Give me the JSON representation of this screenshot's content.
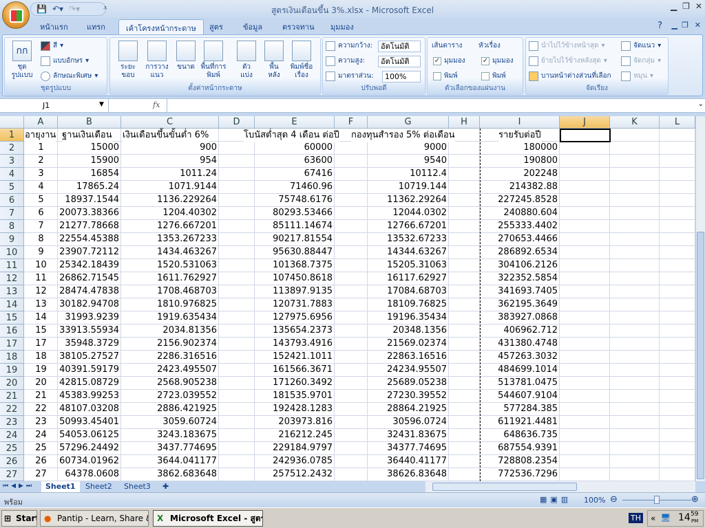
{
  "window": {
    "title": "สูตรเงินเดือนขึ้น 3%.xlsx - Microsoft Excel"
  },
  "ribbon_tabs": [
    "หน้าแรก",
    "แทรก",
    "เค้าโครงหน้ากระดาษ",
    "สูตร",
    "ข้อมูล",
    "ตรวจทาน",
    "มุมมอง"
  ],
  "active_tab": "เค้าโครงหน้ากระดาษ",
  "groups": {
    "themes": {
      "label": "ชุดรูปแบบ",
      "themes_btn": "ชุด\nรูปแบบ",
      "colors": "สี",
      "fonts": "แบบอักษร",
      "effects": "ลักษณะพิเศษ"
    },
    "page_setup": {
      "label": "ตั้งค่าหน้ากระดาษ",
      "items": [
        "ระยะ\nขอบ",
        "การวาง\nแนว",
        "ขนาด",
        "พื้นที่การ\nพิมพ์",
        "ตัว\nแบ่ง",
        "พื้น\nหลัง",
        "พิมพ์ชื่อ\nเรื่อง"
      ]
    },
    "scale": {
      "label": "ปรับพอดี",
      "width_label": "ความกว้าง:",
      "width_value": "อัตโนมัติ",
      "height_label": "ความสูง:",
      "height_value": "อัตโนมัติ",
      "scale_label": "มาตราส่วน:",
      "scale_value": "100%"
    },
    "sheet_options": {
      "label": "ตัวเลือกของแผ่นงาน",
      "gridlines": "เส้นตาราง",
      "headings": "หัวเรื่อง",
      "view": "มุมมอง",
      "print": "พิมพ์",
      "gridlines_view": true,
      "gridlines_print": false,
      "headings_view": true,
      "headings_print": false
    },
    "arrange": {
      "label": "จัดเรียง",
      "bring_front": "นำไปไว้ข้างหน้าสุด",
      "send_back": "ย้ายไปไว้ข้างหลังสุด",
      "selection_pane": "บานหน้าต่างส่วนที่เลือก",
      "align": "จัดแนว",
      "group": "จัดกลุ่ม",
      "rotate": "หมุน"
    }
  },
  "formula_bar": {
    "name_box": "J1",
    "fx": "fx",
    "formula": ""
  },
  "columns": [
    "A",
    "B",
    "C",
    "D",
    "E",
    "F",
    "G",
    "H",
    "I",
    "J",
    "K",
    "L"
  ],
  "active_cell": "J1",
  "headers": {
    "A": "อายุงาน",
    "B": "ฐานเงินเดือน",
    "C": "เงินเดือนขึ้นขั้นต่ำ 6%",
    "E": "โบนัสต่ำสุด 4 เดือน ต่อปี",
    "G": "กองทุนสำรอง 5% ต่อเดือน",
    "I": "รายรับต่อปี"
  },
  "rows": [
    [
      "1",
      "15000",
      "900",
      "60000",
      "9000",
      "180000"
    ],
    [
      "2",
      "15900",
      "954",
      "63600",
      "9540",
      "190800"
    ],
    [
      "3",
      "16854",
      "1011.24",
      "67416",
      "10112.4",
      "202248"
    ],
    [
      "4",
      "17865.24",
      "1071.9144",
      "71460.96",
      "10719.144",
      "214382.88"
    ],
    [
      "5",
      "18937.1544",
      "1136.229264",
      "75748.6176",
      "11362.29264",
      "227245.8528"
    ],
    [
      "6",
      "20073.38366",
      "1204.40302",
      "80293.53466",
      "12044.0302",
      "240880.604"
    ],
    [
      "7",
      "21277.78668",
      "1276.667201",
      "85111.14674",
      "12766.67201",
      "255333.4402"
    ],
    [
      "8",
      "22554.45388",
      "1353.267233",
      "90217.81554",
      "13532.67233",
      "270653.4466"
    ],
    [
      "9",
      "23907.72112",
      "1434.463267",
      "95630.88447",
      "14344.63267",
      "286892.6534"
    ],
    [
      "10",
      "25342.18439",
      "1520.531063",
      "101368.7375",
      "15205.31063",
      "304106.2126"
    ],
    [
      "11",
      "26862.71545",
      "1611.762927",
      "107450.8618",
      "16117.62927",
      "322352.5854"
    ],
    [
      "12",
      "28474.47838",
      "1708.468703",
      "113897.9135",
      "17084.68703",
      "341693.7405"
    ],
    [
      "13",
      "30182.94708",
      "1810.976825",
      "120731.7883",
      "18109.76825",
      "362195.3649"
    ],
    [
      "14",
      "31993.9239",
      "1919.635434",
      "127975.6956",
      "19196.35434",
      "383927.0868"
    ],
    [
      "15",
      "33913.55934",
      "2034.81356",
      "135654.2373",
      "20348.1356",
      "406962.712"
    ],
    [
      "17",
      "35948.3729",
      "2156.902374",
      "143793.4916",
      "21569.02374",
      "431380.4748"
    ],
    [
      "18",
      "38105.27527",
      "2286.316516",
      "152421.1011",
      "22863.16516",
      "457263.3032"
    ],
    [
      "19",
      "40391.59179",
      "2423.495507",
      "161566.3671",
      "24234.95507",
      "484699.1014"
    ],
    [
      "20",
      "42815.08729",
      "2568.905238",
      "171260.3492",
      "25689.05238",
      "513781.0475"
    ],
    [
      "21",
      "45383.99253",
      "2723.039552",
      "181535.9701",
      "27230.39552",
      "544607.9104"
    ],
    [
      "22",
      "48107.03208",
      "2886.421925",
      "192428.1283",
      "28864.21925",
      "577284.385"
    ],
    [
      "23",
      "50993.45401",
      "3059.60724",
      "203973.816",
      "30596.0724",
      "611921.4481"
    ],
    [
      "24",
      "54053.06125",
      "3243.183675",
      "216212.245",
      "32431.83675",
      "648636.735"
    ],
    [
      "25",
      "57296.24492",
      "3437.774695",
      "229184.9797",
      "34377.74695",
      "687554.9391"
    ],
    [
      "26",
      "60734.01962",
      "3644.041177",
      "242936.0785",
      "36440.41177",
      "728808.2354"
    ],
    [
      "27",
      "64378.0608",
      "3862.683648",
      "257512.2432",
      "38626.83648",
      "772536.7296"
    ]
  ],
  "sheets": [
    "Sheet1",
    "Sheet2",
    "Sheet3"
  ],
  "active_sheet": "Sheet1",
  "status": {
    "ready": "พร้อม",
    "zoom": "100%",
    "zoom_level": 100
  },
  "taskbar": {
    "start": "Start",
    "items": [
      "Pantip - Learn, Share & ...",
      "Microsoft Excel - สูตรเ..."
    ],
    "lang": "TH",
    "time": "14",
    "time_min": "59",
    "ampm": "PM"
  }
}
